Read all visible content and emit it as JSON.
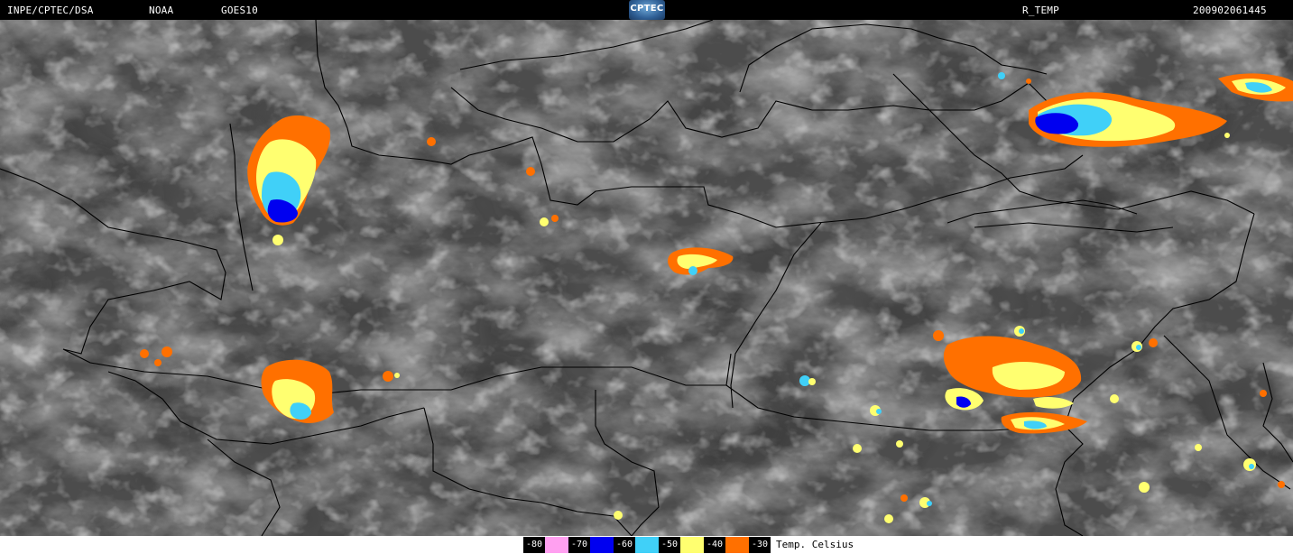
{
  "header": {
    "source": "INPE/CPTEC/DSA",
    "agency": "NOAA",
    "satellite": "GOES10",
    "logo_text": "CPTEC",
    "product": "R_TEMP",
    "timestamp": "200902061445"
  },
  "legend": {
    "unit_label": "Temp. Celsius",
    "entries": [
      {
        "label": "-80",
        "color": "#ffa0f0"
      },
      {
        "label": "-70",
        "color": "#0000f0"
      },
      {
        "label": "-60",
        "color": "#40d0f8"
      },
      {
        "label": "-50",
        "color": "#ffff70"
      },
      {
        "label": "-40",
        "color": "#ff7000"
      },
      {
        "label": "-30",
        "color": ""
      }
    ]
  },
  "colors": {
    "cloud_base": "#4a4a4a",
    "border": "#000000"
  }
}
